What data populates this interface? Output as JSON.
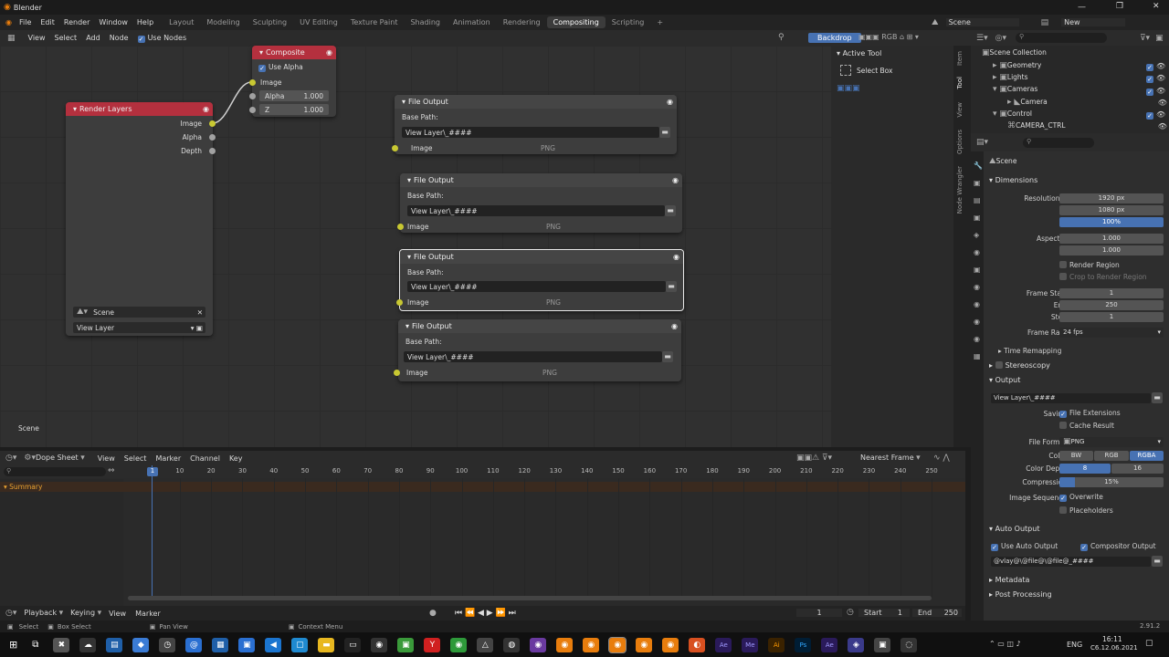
{
  "app": {
    "title": "Blender",
    "version": "2.91.2"
  },
  "menu": {
    "items": [
      "File",
      "Edit",
      "Render",
      "Window",
      "Help"
    ]
  },
  "workspaces": [
    "Layout",
    "Modeling",
    "Sculpting",
    "UV Editing",
    "Texture Paint",
    "Shading",
    "Animation",
    "Rendering",
    "Compositing",
    "Scripting"
  ],
  "scene_selector": {
    "scene": "Scene",
    "layer": "New"
  },
  "node_editor": {
    "header": {
      "view": "View",
      "select": "Select",
      "add": "Add",
      "node": "Node",
      "use_nodes": "Use Nodes",
      "backdrop": "Backdrop"
    },
    "scene_label": "Scene",
    "composite": {
      "title": "Composite",
      "use_alpha": "Use Alpha",
      "image": "Image",
      "alpha_label": "Alpha",
      "alpha_value": "1.000",
      "z_label": "Z",
      "z_value": "1.000"
    },
    "render_layers": {
      "title": "Render Layers",
      "outputs": [
        "Image",
        "Alpha",
        "Depth"
      ],
      "scene": "Scene",
      "view_layer": "View Layer"
    },
    "file_output": {
      "title": "File Output",
      "base_path_label": "Base Path:",
      "path": "View Layer\\_####",
      "input": "Image",
      "format": "PNG"
    }
  },
  "side_panel": {
    "active_tool": "Active Tool",
    "tool": "Select Box",
    "tabs": [
      "Item",
      "Tool",
      "View",
      "Options",
      "Node Wrangler"
    ]
  },
  "outliner": {
    "items": [
      {
        "label": "Scene Collection"
      },
      {
        "label": "Geometry"
      },
      {
        "label": "Lights"
      },
      {
        "label": "Cameras"
      },
      {
        "label": "Camera"
      },
      {
        "label": "Control"
      },
      {
        "label": "CAMERA_CTRL"
      }
    ]
  },
  "properties": {
    "scene": "Scene",
    "dimensions": {
      "title": "Dimensions",
      "resolution_x_label": "Resolution X",
      "resolution_x": "1920 px",
      "y_label": "Y",
      "resolution_y": "1080 px",
      "pct_label": "%",
      "pct": "100%",
      "aspect_x_label": "Aspect X",
      "aspect_x": "1.000",
      "aspect_y_label": "Y",
      "aspect_y": "1.000",
      "render_region": "Render Region",
      "crop": "Crop to Render Region",
      "frame_start_label": "Frame Start",
      "frame_start": "1",
      "end_label": "End",
      "end": "250",
      "step_label": "Step",
      "step": "1",
      "frame_rate_label": "Frame Rate",
      "frame_rate": "24 fps",
      "time_remapping": "Time Remapping"
    },
    "stereoscopy": "Stereoscopy",
    "output": {
      "title": "Output",
      "path": "View Layer\\_####",
      "saving_label": "Saving",
      "file_ext": "File Extensions",
      "cache": "Cache Result",
      "file_format_label": "File Format",
      "file_format": "PNG",
      "color_label": "Color",
      "color_options": [
        "BW",
        "RGB",
        "RGBA"
      ],
      "depth_label": "Color Depth",
      "depth_options": [
        "8",
        "16"
      ],
      "compression_label": "Compression",
      "compression": "15%",
      "image_seq_label": "Image Sequence",
      "overwrite": "Overwrite",
      "placeholders": "Placeholders"
    },
    "auto_output": {
      "title": "Auto Output",
      "use_auto": "Use Auto Output",
      "compositor_output": "Compositor Output",
      "pattern": "@vlay@\\@file@\\@file@_####"
    },
    "metadata": "Metadata",
    "post_processing": "Post Processing"
  },
  "dopesheet": {
    "mode": "Dope Sheet",
    "view": "View",
    "select": "Select",
    "marker": "Marker",
    "channel": "Channel",
    "key": "Key",
    "nearest_frame": "Nearest Frame",
    "summary": "Summary",
    "current_frame": "1",
    "ticks": [
      "10",
      "20",
      "30",
      "40",
      "50",
      "60",
      "70",
      "80",
      "90",
      "100",
      "110",
      "120",
      "130",
      "140",
      "150",
      "160",
      "170",
      "180",
      "190",
      "200",
      "210",
      "220",
      "230",
      "240",
      "250"
    ]
  },
  "timeline": {
    "playback": "Playback",
    "keying": "Keying",
    "view": "View",
    "marker": "Marker",
    "frame": "1",
    "start_label": "Start",
    "start": "1",
    "end_label": "End",
    "end": "250"
  },
  "status": {
    "select": "Select",
    "box_select": "Box Select",
    "pan_view": "Pan View",
    "context_menu": "Context Menu"
  },
  "taskbar": {
    "lang": "ENG",
    "time": "16:11",
    "date": "С6.12.06.2021"
  },
  "colors": {
    "accent": "#4772b3",
    "node_header_red": "#b4303e",
    "socket_yellow": "#c8c832",
    "playhead": "#4772b3"
  }
}
